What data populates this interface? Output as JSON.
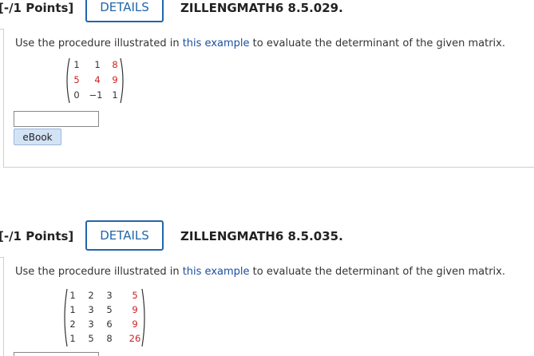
{
  "q1": {
    "points": "[-/1 Points]",
    "details": "DETAILS",
    "id": "ZILLENGMATH6 8.5.029.",
    "prompt_pre": "Use the procedure illustrated in ",
    "prompt_link": "this example",
    "prompt_post": " to evaluate the determinant of the given matrix.",
    "matrix": [
      [
        "1",
        "1",
        "8"
      ],
      [
        "5",
        "4",
        "9"
      ],
      [
        "0",
        "−1",
        "1"
      ]
    ],
    "answer_value": "",
    "ebook": "eBook"
  },
  "q2": {
    "points": "[-/1 Points]",
    "details": "DETAILS",
    "id": "ZILLENGMATH6 8.5.035.",
    "prompt_pre": "Use the procedure illustrated in ",
    "prompt_link": "this example",
    "prompt_post": " to evaluate the determinant of the given matrix.",
    "matrix": [
      [
        "1",
        "2",
        "3",
        "5"
      ],
      [
        "1",
        "3",
        "5",
        "9"
      ],
      [
        "2",
        "3",
        "6",
        "9"
      ],
      [
        "1",
        "5",
        "8",
        "26"
      ]
    ]
  },
  "colors": {
    "accent": "#2266aa",
    "link": "#1a4fa0",
    "red_entry": "#cc2222",
    "ebook_bg": "#d3e3f6"
  }
}
